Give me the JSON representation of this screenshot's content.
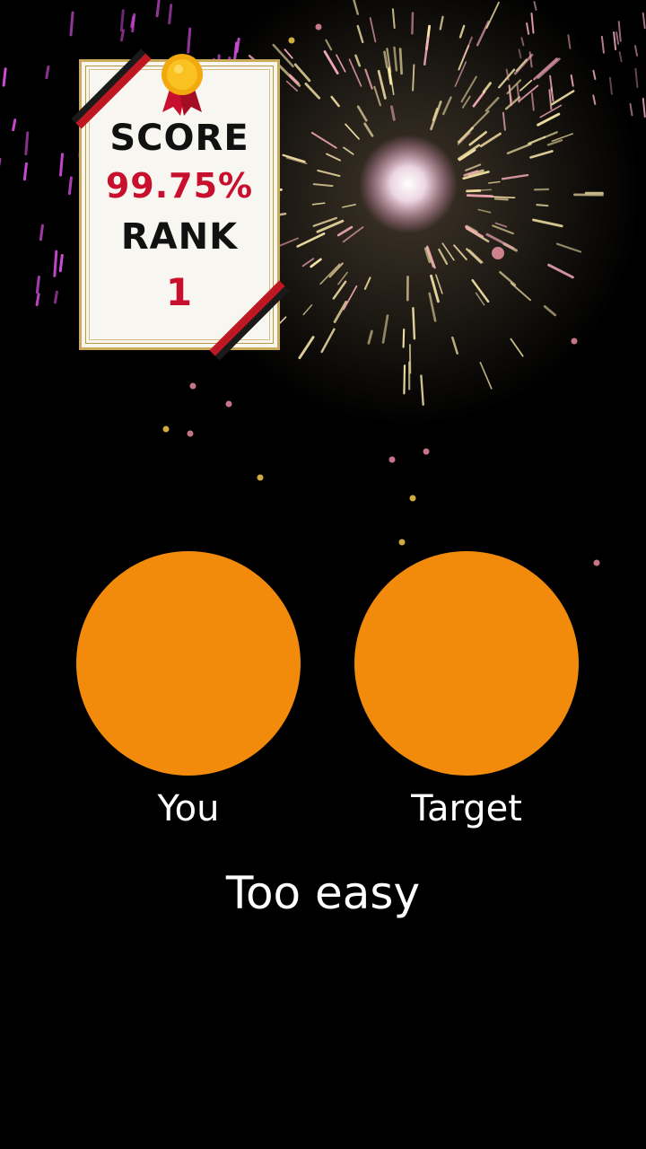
{
  "scorecard": {
    "score_label": "SCORE",
    "score_value": "99.75%",
    "rank_label": "RANK",
    "rank_value": "1"
  },
  "colors": {
    "you": "#f28b0c",
    "target": "#f28b0c",
    "score_accent": "#c8102e",
    "background": "#000000"
  },
  "comparison": {
    "you_label": "You",
    "target_label": "Target"
  },
  "verdict": "Too easy"
}
